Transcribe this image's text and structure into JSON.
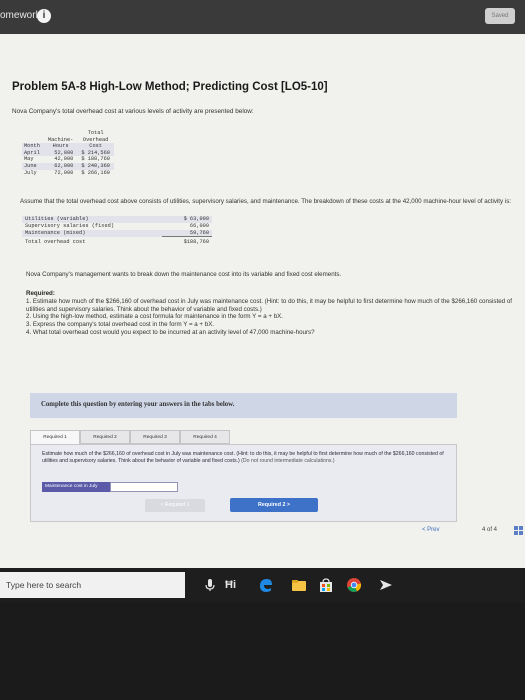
{
  "header": {
    "title": "omework",
    "info_glyph": "i",
    "saved_label": "Saved"
  },
  "problem": {
    "title": "Problem 5A-8 High-Low Method; Predicting Cost [LO5-10]",
    "intro": "Nova Company's total overhead cost at various levels of activity are presented below:"
  },
  "activity_table": {
    "headers": {
      "month": "Month",
      "hours_line1": "Machine-",
      "hours_line2": "Hours",
      "cost_line1": "Total",
      "cost_line2": "Overhead",
      "cost_line3": "Cost"
    },
    "rows": [
      {
        "month": "April",
        "hours": "52,000",
        "cost": "$ 214,560"
      },
      {
        "month": "May",
        "hours": "42,000",
        "cost": "$ 188,760"
      },
      {
        "month": "June",
        "hours": "62,000",
        "cost": "$ 240,360"
      },
      {
        "month": "July",
        "hours": "72,000",
        "cost": "$ 266,160"
      }
    ]
  },
  "assume_text": "Assume that the total overhead cost above consists of utilities, supervisory salaries, and maintenance. The breakdown of these costs at the 42,000 machine-hour level of activity is:",
  "breakdown": {
    "rows": [
      {
        "label": "Utilities (variable)",
        "value": "$ 63,000"
      },
      {
        "label": "Supervisory salaries (fixed)",
        "value": "66,000"
      },
      {
        "label": "Maintenance (mixed)",
        "value": "59,760"
      }
    ],
    "total_label": "Total overhead cost",
    "total_value": "$188,760"
  },
  "management_text": "Nova Company's management wants to break down the maintenance cost into its variable and fixed cost elements.",
  "required": {
    "label": "Required:",
    "items": [
      "1. Estimate how much of the $266,160 of overhead cost in July was maintenance cost. (Hint: to do this, it may be helpful to first determine how much of the $266,160 consisted of utilities and supervisory salaries. Think about the behavior of variable and fixed costs.)",
      "2. Using the high-low method, estimate a cost formula for maintenance in the form Y = a + bX.",
      "3. Express the company's total overhead cost in the form Y = a + bX.",
      "4. What total overhead cost would you expect to be incurred at an activity level of 47,000 machine-hours?"
    ]
  },
  "complete_banner": "Complete this question by entering your answers in the tabs below.",
  "tabs": [
    {
      "label": "Required 1"
    },
    {
      "label": "Required 2"
    },
    {
      "label": "Required 3"
    },
    {
      "label": "Required 4"
    }
  ],
  "panel": {
    "instruction": "Estimate how much of the $266,160 of overhead cost in July was maintenance cost. (Hint: to do this, it may be helpful to first determine how much of the $266,160 consisted of utilities and supervisory salaries. Think about the behavior of variable and fixed costs.)",
    "instruction_note": "(Do not round intermediate calculations.)",
    "answer_label": "Maintenance cost in July",
    "answer_value": ""
  },
  "nav": {
    "prev_label": "< Required 1",
    "next_label": "Required 2  >"
  },
  "pager": {
    "prev_label": "< Prev",
    "count": "4 of 4"
  },
  "taskbar": {
    "search_placeholder": "Type here to search",
    "task_view_glyph": "Ħi"
  }
}
